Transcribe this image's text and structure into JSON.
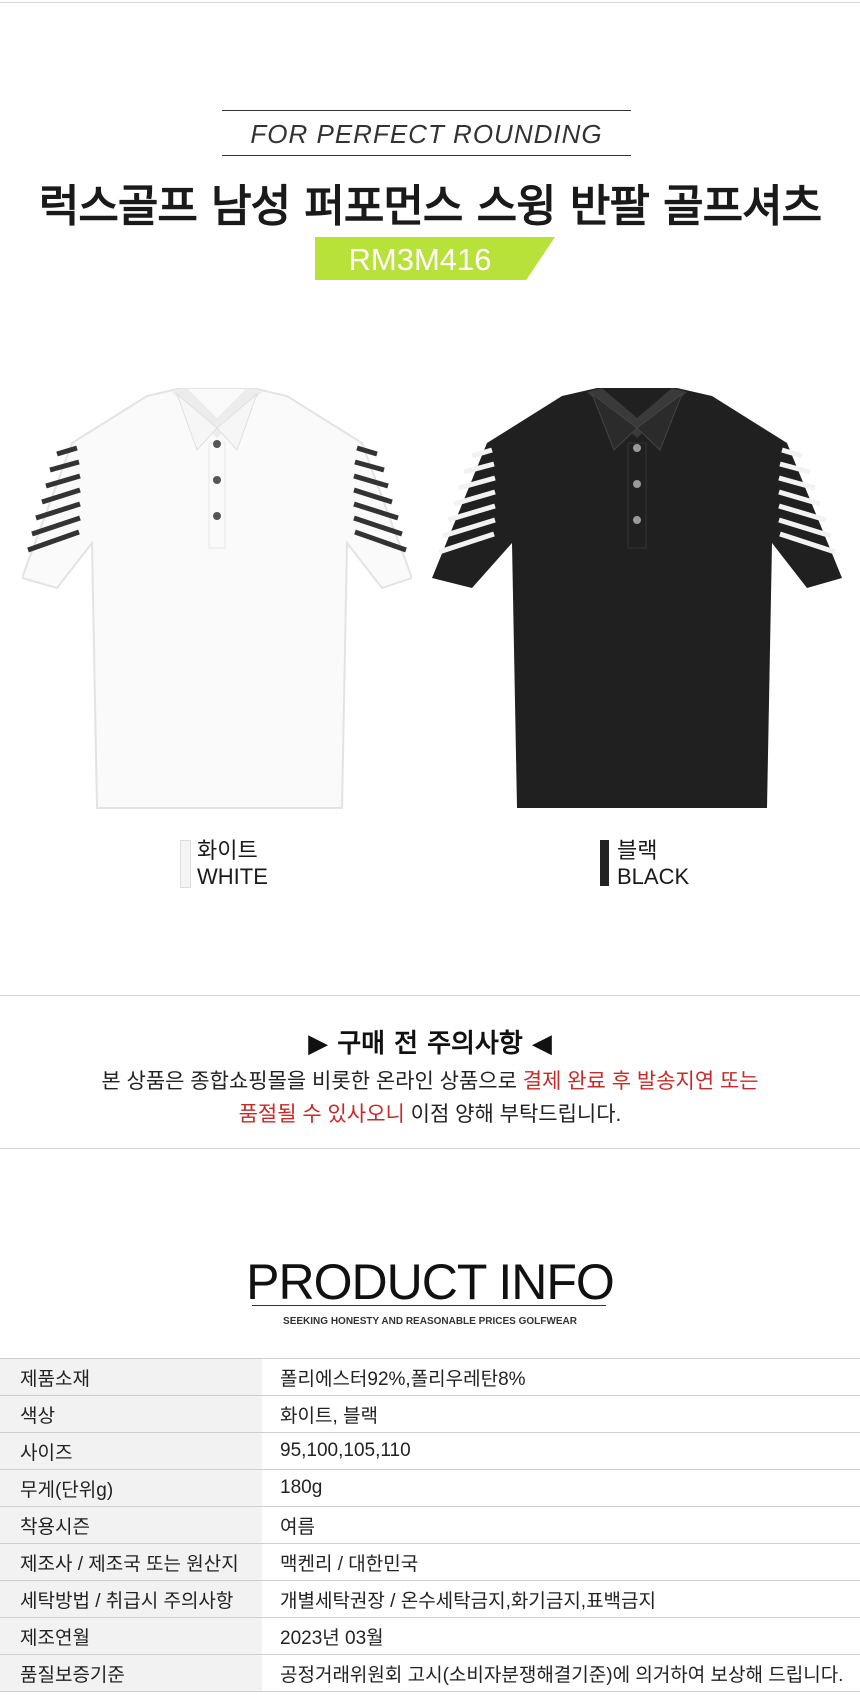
{
  "header": {
    "tagline": "FOR PERFECT ROUNDING",
    "title": "럭스골프 남성 퍼포먼스 스윙 반팔 골프셔츠",
    "model_code": "RM3M416"
  },
  "colors_options": [
    {
      "kr": "화이트",
      "en": "WHITE",
      "swatch": "#f4f4f4"
    },
    {
      "kr": "블랙",
      "en": "BLACK",
      "swatch": "#222222"
    }
  ],
  "notice": {
    "title": "▶ 구매 전 주의사항 ◀",
    "line1_plain": "본 상품은 종합쇼핑몰을 비롯한 온라인 상품으로 ",
    "line1_red": "결제 완료 후 발송지연 또는",
    "line2_red": "품절될 수 있사오니",
    "line2_plain": " 이점 양해 부탁드립니다."
  },
  "product_info": {
    "title": "PRODUCT INFO",
    "subtitle": "SEEKING HONESTY AND REASONABLE PRICES GOLFWEAR",
    "rows": [
      {
        "label": "제품소재",
        "value": "폴리에스터92%,폴리우레탄8%"
      },
      {
        "label": "색상",
        "value": "화이트, 블랙"
      },
      {
        "label": "사이즈",
        "value": "95,100,105,110"
      },
      {
        "label": "무게(단위g)",
        "value": "180g"
      },
      {
        "label": "착용시즌",
        "value": "여름"
      },
      {
        "label": "제조사 / 제조국 또는 원산지",
        "value": "맥켄리 / 대한민국"
      },
      {
        "label": "세탁방법 / 취급시 주의사항",
        "value": "개별세탁권장 / 온수세탁금지,화기금지,표백금지"
      },
      {
        "label": "제조연월",
        "value": "2023년 03월"
      },
      {
        "label": "품질보증기준",
        "value": "공정거래위원회 고시(소비자분쟁해결기준)에 의거하여  보상해 드립니다."
      }
    ]
  },
  "theme": {
    "accent": "#b8e13a",
    "notice_red": "#c42a2a"
  }
}
